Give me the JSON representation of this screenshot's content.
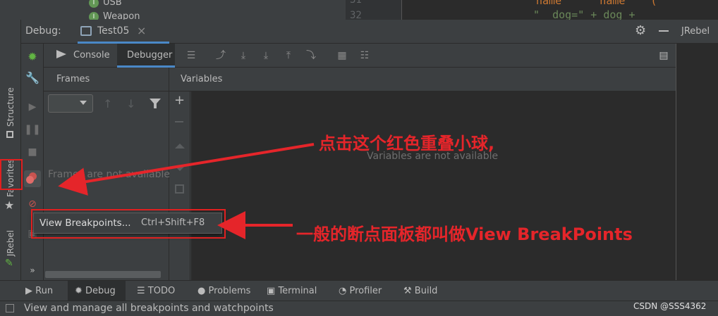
{
  "project_peek": {
    "items": [
      {
        "label": "USB",
        "icon_letter": "I"
      },
      {
        "label": "Weapon",
        "icon_letter": "I"
      }
    ]
  },
  "editor_peek": {
    "line_top": "31",
    "line_bottom": "32",
    "code_top": "name      name    (",
    "code_bottom": "\"  dog=\" + dog +"
  },
  "debug_header": {
    "title": "Debug:",
    "tab_label": "Test05",
    "close_glyph": "×"
  },
  "right_panel": {
    "title": "JRebel"
  },
  "left_strip": {
    "structure": "Structure",
    "favorites": "Favorites",
    "jrebel": "JRebel",
    "more": "»"
  },
  "toolbar": {
    "console_label": "Console",
    "debugger_label": "Debugger"
  },
  "frames": {
    "header": "Frames",
    "empty_text": "Frames are not available"
  },
  "variables": {
    "header": "Variables",
    "empty_text": "Variables are not available"
  },
  "popup": {
    "label": "View Breakpoints...",
    "shortcut": "Ctrl+Shift+F8"
  },
  "bottom_bar": {
    "run": "Run",
    "debug": "Debug",
    "todo": "TODO",
    "problems": "Problems",
    "terminal": "Terminal",
    "profiler": "Profiler",
    "build": "Build"
  },
  "status_bar": {
    "message": "View and manage all breakpoints and watchpoints",
    "watermark": "CSDN @SSS4362"
  },
  "annotations": {
    "note_top": "点击这个红色重叠小球,",
    "note_bottom": "一般的断点面板都叫做View BreakPoints"
  },
  "colors": {
    "accent": "#4a88c7",
    "annotation_red": "#e5252a",
    "panel_bg": "#3c3f41",
    "editor_bg": "#2b2b2b"
  }
}
